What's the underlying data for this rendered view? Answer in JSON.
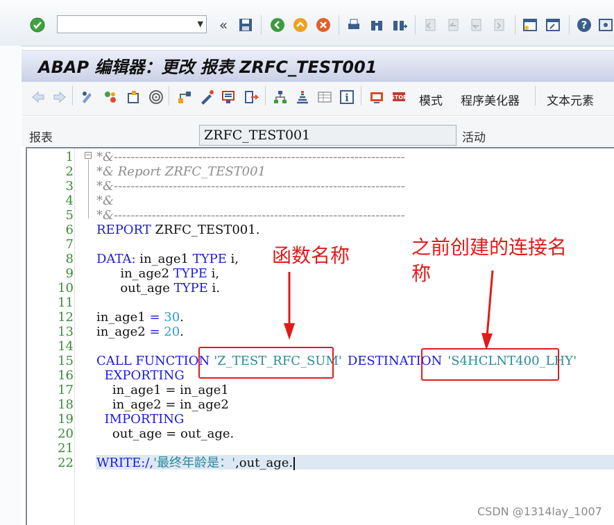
{
  "toolbar": {
    "command_value": "",
    "icons": [
      "enter-check-icon",
      "back-icon",
      "save-icon",
      "exit-icon",
      "cancel-icon",
      "print-icon",
      "find-icon",
      "find-next-icon",
      "first-page-icon",
      "previous-page-icon",
      "next-page-icon",
      "last-page-icon",
      "new-session-icon",
      "shortcut-icon",
      "help-icon",
      "customize-layout-icon"
    ]
  },
  "header": {
    "title": "ABAP 编辑器：更改 报表 ZRFC_TEST001"
  },
  "app_toolbar": {
    "mode_label": "模式",
    "pretty_printer_label": "程序美化器",
    "text_elements_label": "文本元素"
  },
  "fields": {
    "report_label": "报表",
    "report_value": "ZRFC_TEST001",
    "status_label": "活动"
  },
  "code": {
    "line_numbers": [
      "1",
      "2",
      "3",
      "4",
      "5",
      "6",
      "7",
      "8",
      "9",
      "10",
      "11",
      "12",
      "13",
      "14",
      "15",
      "16",
      "17",
      "18",
      "19",
      "20",
      "21",
      "22"
    ],
    "l1": "*&---------------------------------------------------------------------",
    "l2": "*& Report ZRFC_TEST001",
    "l3": "*&---------------------------------------------------------------------",
    "l4": "*&",
    "l5": "*&---------------------------------------------------------------------",
    "l6_kw": "REPORT",
    "l6_rest": " ZRFC_TEST001.",
    "l8_kw": "DATA:",
    "l8_a": " in_age1 ",
    "l8_type": "TYPE",
    "l8_b": " i,",
    "l9_a": "      in_age2 ",
    "l9_type": "TYPE",
    "l9_b": " i,",
    "l10_a": "      out_age ",
    "l10_type": "TYPE",
    "l10_b": " i.",
    "l12_a": "in_age1 ",
    "l12_eq": "=",
    "l12_num": " 30",
    "l12_b": ".",
    "l13_a": "in_age2 ",
    "l13_eq": "=",
    "l13_num": " 20",
    "l13_b": ".",
    "l15_kw": "CALL FUNCTION",
    "l15_str": "'Z_TEST_RFC_SUM'",
    "l15_kw2": "DESTINATION",
    "l15_str2": "'S4HCLNT400_LHY'",
    "l16_kw": "  EXPORTING",
    "l17": "    in_age1 = in_age1",
    "l18": "    in_age2 = in_age2",
    "l19_kw": "  IMPORTING",
    "l20": "    out_age = out_age.",
    "l22_kw": "WRITE:/,",
    "l22_str": "'最终年龄是：'",
    "l22_rest": ",out_age."
  },
  "annotations": {
    "function_name_note": "函数名称",
    "destination_note_line1": "之前创建的连接名",
    "destination_note_line2": "称"
  },
  "watermark": "CSDN @1314lay_1007",
  "colors": {
    "keyword": "#1a1ad6",
    "comment": "#8c8c8c",
    "number": "#2a9ad6",
    "string": "#2a8a9a",
    "line_number": "#3a8a3a",
    "annotation_red": "#e21a1a"
  }
}
